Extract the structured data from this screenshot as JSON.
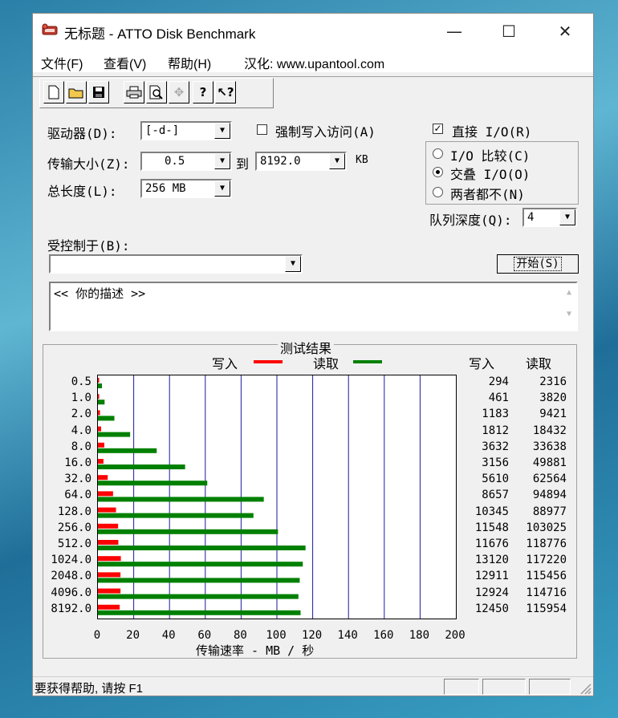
{
  "window": {
    "title": "无标题 - ATTO Disk Benchmark",
    "minimize": "—",
    "maximize": "☐",
    "close": "✕"
  },
  "menu": [
    "文件(F)",
    "查看(V)",
    "帮助(H)",
    "汉化: www.upantool.com"
  ],
  "form": {
    "drive_label": "驱动器(D):",
    "drive_value": "[-d-]",
    "force_write_label": "强制写入访问(A)",
    "force_write_checked": false,
    "direct_io_label": "直接 I/O(R)",
    "direct_io_checked": true,
    "transfer_label": "传输大小(Z):",
    "transfer_from": "0.5",
    "to_label": "到",
    "transfer_to": "8192.0",
    "kb_label": "KB",
    "length_label": "总长度(L):",
    "length_value": "256 MB",
    "io_compare_label": "I/O 比较(C)",
    "overlapped_io_label": "交叠 I/O(O)",
    "neither_label": "两者都不(N)",
    "selected_mode": "overlapped",
    "queue_label": "队列深度(Q):",
    "queue_value": "4",
    "controlled_label": "受控制于(B):",
    "controlled_value": "",
    "start_button": "开始(S)",
    "description": "<<  你的描述  >>"
  },
  "results": {
    "title": "测试结果",
    "legend_write": "写入",
    "legend_read": "读取",
    "col_write": "写入",
    "col_read": "读取"
  },
  "chart_data": {
    "type": "bar",
    "orientation": "horizontal",
    "xlabel": "传输速率 - MB / 秒",
    "xlim": [
      0,
      200
    ],
    "xticks": [
      "0",
      "20",
      "40",
      "60",
      "80",
      "100",
      "120",
      "140",
      "160",
      "180",
      "200"
    ],
    "categories": [
      "0.5",
      "1.0",
      "2.0",
      "4.0",
      "8.0",
      "16.0",
      "32.0",
      "64.0",
      "128.0",
      "256.0",
      "512.0",
      "1024.0",
      "2048.0",
      "4096.0",
      "8192.0"
    ],
    "series": [
      {
        "name": "写入",
        "color": "#ff0000",
        "values": [
          294,
          461,
          1183,
          1812,
          3632,
          3156,
          5610,
          8657,
          10345,
          11548,
          11676,
          13120,
          12911,
          12924,
          12450
        ]
      },
      {
        "name": "读取",
        "color": "#008000",
        "values": [
          2316,
          3820,
          9421,
          18432,
          33638,
          49881,
          62564,
          94894,
          88977,
          103025,
          118776,
          117220,
          115456,
          114716,
          115954
        ]
      }
    ],
    "write_table": [
      "294",
      "461",
      "1183",
      "1812",
      "3632",
      "3156",
      "5610",
      "8657",
      "10345",
      "11548",
      "11676",
      "13120",
      "12911",
      "12924",
      "12450"
    ],
    "read_table": [
      "2316",
      "3820",
      "9421",
      "18432",
      "33638",
      "49881",
      "62564",
      "94894",
      "88977",
      "103025",
      "118776",
      "117220",
      "115456",
      "114716",
      "115954"
    ],
    "grid": true
  },
  "status": {
    "text": "要获得帮助, 请按 F1"
  }
}
